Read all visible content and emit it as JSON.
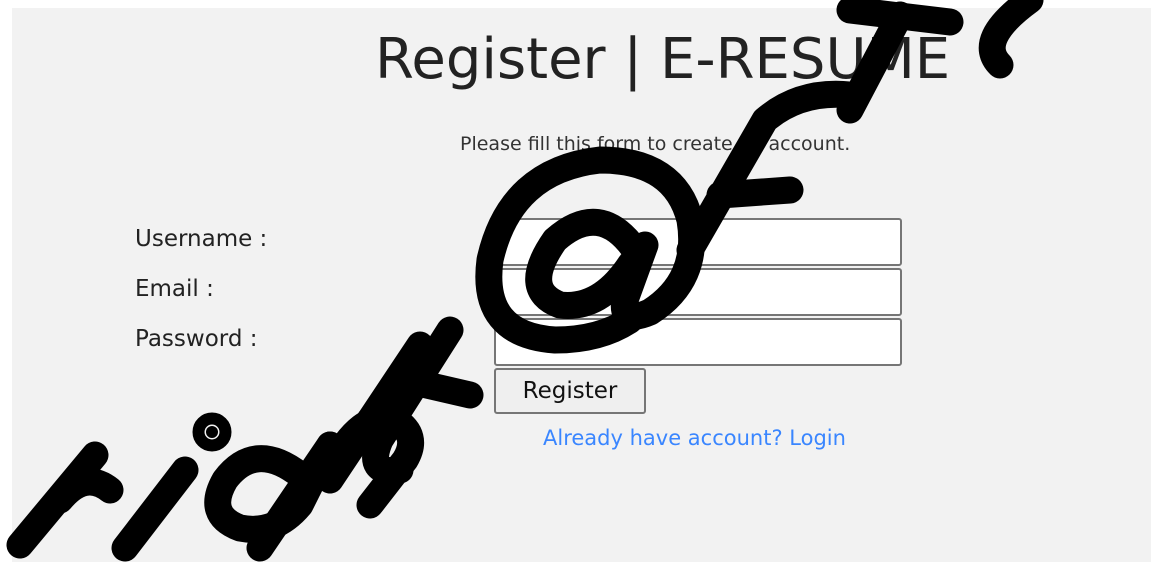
{
  "header": {
    "title": "Register | E-RESUME",
    "subtitle": "Please fill this form to create an account."
  },
  "form": {
    "username": {
      "label": "Username :",
      "value": ""
    },
    "email": {
      "label": "Email :",
      "value": ""
    },
    "password": {
      "label": "Password :",
      "value": ""
    },
    "submit_label": "Register",
    "login_link": "Already have account? Login"
  },
  "watermark": {
    "text": "Copyright@FTS",
    "color": "#000000"
  }
}
